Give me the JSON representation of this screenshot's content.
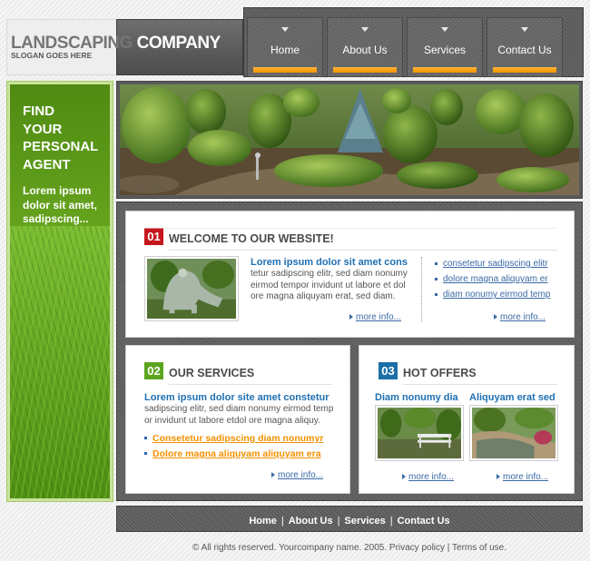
{
  "logo": {
    "part1": "LANDSCAPING",
    "part2": "COMPANY",
    "slogan": "SLOGAN GOES HERE"
  },
  "nav": {
    "items": [
      {
        "label": "Home"
      },
      {
        "label": "About Us"
      },
      {
        "label": "Services"
      },
      {
        "label": "Contact Us"
      }
    ],
    "accent_color": "#f39200"
  },
  "sidebar": {
    "headline": "FIND\nYOUR\nPERSONAL\nAGENT",
    "text": "Lorem ipsum dolor sit amet, sadipscing..."
  },
  "welcome": {
    "number": "01",
    "title": "WELCOME TO  OUR WEBSITE!",
    "heading": "Lorem ipsum dolor sit amet cons",
    "body": "tetur sadipscing elitr, sed diam nonumy eirmod tempor invidunt ut labore et dol ore magna aliquyam erat, sed diam.",
    "more_left": "more info...",
    "links": [
      "consetetur sadipscing elitr",
      "dolore magna aliquyam er",
      "diam nonumy eirmod temp"
    ],
    "more_right": "more info..."
  },
  "services": {
    "number": "02",
    "title": "OUR SERVICES",
    "heading": "Lorem ipsum dolor site amet constetur",
    "body": "sadipscing elitr, sed diam nonumy eirmod temp or invidunt ut labore etdol ore magna aliquy.",
    "links": [
      "Consetetur sadipscing diam nonumyr",
      "Dolore magna aliquyam aliquyam era"
    ],
    "more": "more info..."
  },
  "offers": {
    "number": "03",
    "title": "HOT OFFERS",
    "items": [
      {
        "caption": "Diam nonumy dia",
        "more": "more info..."
      },
      {
        "caption": "Aliquyam erat sed",
        "more": "more info..."
      }
    ]
  },
  "footer": {
    "links": [
      "Home",
      "About Us",
      "Services",
      "Contact Us"
    ],
    "copyright": "© All rights reserved. Yourcompany name. 2005. Privacy policy | Terms of use."
  },
  "colors": {
    "green": "#6aac21",
    "blue_text": "#1f6fb2",
    "badge_red": "#c4161c",
    "badge_green": "#5ba51e",
    "badge_blue": "#1c6fa8"
  }
}
